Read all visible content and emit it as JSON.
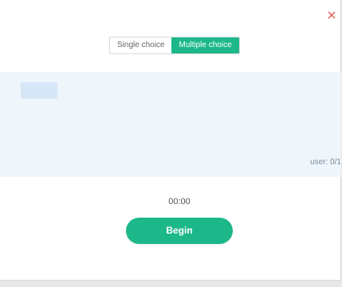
{
  "dialog": {
    "close_icon": "close-icon"
  },
  "mode_toggle": {
    "options": [
      {
        "label": "Single choice",
        "active": false
      },
      {
        "label": "Multiple choice",
        "active": true
      }
    ]
  },
  "panel": {
    "user_count": "user: 0/1"
  },
  "timer": {
    "value": "00:00"
  },
  "actions": {
    "begin_label": "Begin"
  },
  "colors": {
    "accent": "#1db88a",
    "close": "#e0544f",
    "panel_bg": "#eef5fb"
  }
}
